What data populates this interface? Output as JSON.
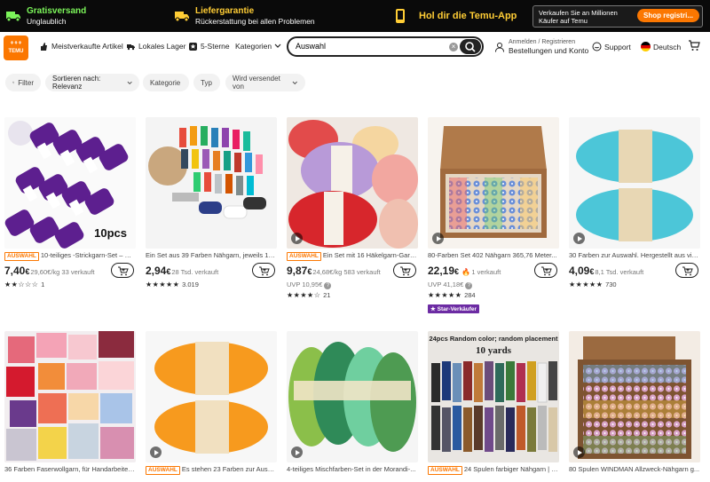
{
  "banner": {
    "shipping_title": "Gratisversand",
    "shipping_sub": "Unglaublich",
    "guarantee_title": "Liefergarantie",
    "guarantee_sub": "Rückerstattung bei allen Problemen",
    "app_label": "Hol dir die Temu-App",
    "seller_text": "Verkaufen Sie an Millionen Käufer auf Temu",
    "seller_button": "Shop registri..."
  },
  "header": {
    "logo_text": "TEMU",
    "nav": [
      "Meistverkaufte Artikel",
      "Lokales Lager",
      "5-Sterne",
      "Kategorien"
    ],
    "search_value": "Auswahl",
    "account_line1": "Anmelden / Registrieren",
    "account_line2": "Bestellungen und Konto",
    "support": "Support",
    "language": "Deutsch"
  },
  "filters": {
    "filter": "Filter",
    "sort": "Sortieren nach: Relevanz",
    "category": "Kategorie",
    "type": "Typ",
    "shipped_by": "Wird versendet von"
  },
  "products": [
    {
      "title": "10-teiliges -Strickgarn-Set – W...",
      "badge": "AUSWAHL",
      "price": "7,40",
      "currency": "€",
      "meta": "29,60€/kg 33 verkauft",
      "uvp": "",
      "stars": "★★☆☆☆",
      "reviews": "1",
      "star_seller": "",
      "image_text": "10pcs"
    },
    {
      "title": "Ein Set aus 39 Farben Nähgarn, jeweils 182...",
      "badge": "",
      "price": "2,94",
      "currency": "€",
      "meta": "28 Tsd. verkauft",
      "uvp": "",
      "stars": "★★★★★",
      "reviews": "3.019",
      "star_seller": "",
      "image_text": ""
    },
    {
      "title": "Ein Set mit 16 Häkelgarn-Garne...",
      "badge": "AUSWAHL",
      "price": "9,87",
      "currency": "€",
      "meta": "24,68€/kg 583 verkauft",
      "uvp": "UVP 10,95€",
      "stars": "★★★★☆",
      "reviews": "21",
      "star_seller": "",
      "image_text": ""
    },
    {
      "title": "80-Farben Set 402 Nähgarn 365,76 Meter...",
      "badge": "",
      "price": "22,19",
      "currency": "€",
      "meta": "1 verkauft",
      "uvp": "UVP 41,18€",
      "stars": "★★★★★",
      "reviews": "284",
      "star_seller": "Star-Verkäufer",
      "image_text": ""
    },
    {
      "title": "30 Farben zur Auswahl. Hergestellt aus vier...",
      "badge": "",
      "price": "4,09",
      "currency": "€",
      "meta": "8,1 Tsd. verkauft",
      "uvp": "",
      "stars": "★★★★★",
      "reviews": "730",
      "star_seller": "",
      "image_text": ""
    },
    {
      "title": "36 Farben Faserwollgarn, für Handarbeiten,...",
      "badge": "",
      "image_text": ""
    },
    {
      "title": "Es stehen 23 Farben zur Auswa...",
      "badge": "AUSWAHL",
      "image_text": ""
    },
    {
      "title": "4-teiliges Mischfarben-Set in der Morandi-...",
      "badge": "",
      "image_text": ""
    },
    {
      "title": "24 Spulen farbiger Nähgarn | 9...",
      "badge": "AUSWAHL",
      "image_text": "24pcs Random color; random placement",
      "image_text2": "10 yards"
    },
    {
      "title": "80 Spulen WINDMAN Allzweck-Nähgarn g...",
      "badge": "",
      "image_text": ""
    }
  ],
  "colors": {
    "accent": "#fb7701",
    "banner_bg": "#0a0a0a",
    "green": "#7cf55a",
    "yellow": "#ffcd35",
    "star_seller": "#6c2ba3"
  }
}
